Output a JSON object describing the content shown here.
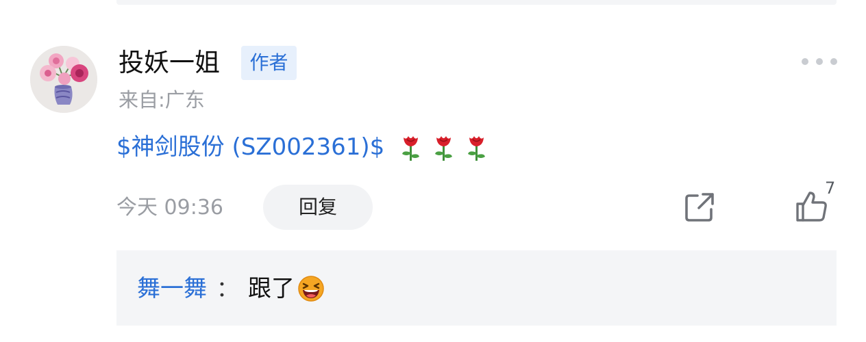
{
  "post": {
    "author": "投妖一姐",
    "author_badge": "作者",
    "location": "来自:广东",
    "content_link": "$神剑股份 (SZ002361)$",
    "content_emojis": [
      "rose-icon",
      "rose-icon",
      "rose-icon"
    ],
    "timestamp": "今天 09:36",
    "reply_label": "回复",
    "like_count": "7"
  },
  "replies": [
    {
      "user": "舞一舞",
      "separator": "：",
      "text": "跟了",
      "emoji": "laughing-face-icon"
    }
  ],
  "colors": {
    "link": "#2a6fd6",
    "badge_bg": "#e7f0fc",
    "muted": "#9a9da3",
    "panel_bg": "#f4f5f7"
  }
}
